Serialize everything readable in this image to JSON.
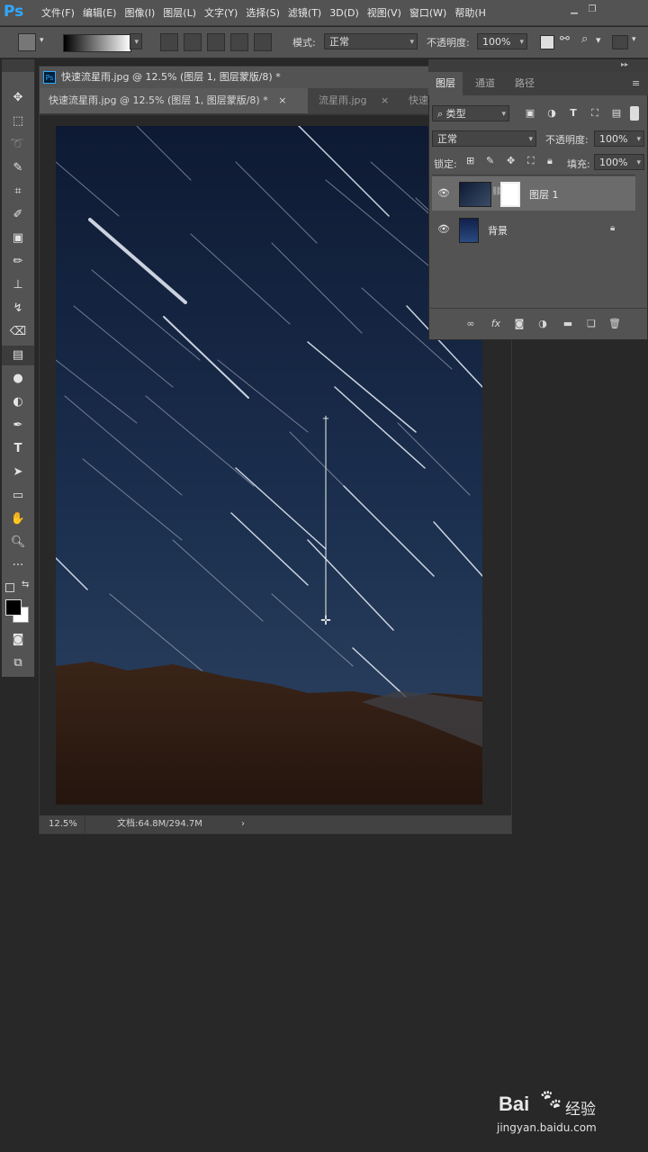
{
  "app": {
    "logo": "Ps",
    "brand_color": "#31a8ff"
  },
  "menu": {
    "items": [
      "文件(F)",
      "编辑(E)",
      "图像(I)",
      "图层(L)",
      "文字(Y)",
      "选择(S)",
      "滤镜(T)",
      "3D(D)",
      "视图(V)",
      "窗口(W)",
      "帮助(H"
    ],
    "window_controls": [
      "minimize-icon",
      "restore-icon"
    ]
  },
  "options_bar": {
    "mode_label": "模式:",
    "mode_value": "正常",
    "opacity_label": "不透明度:",
    "opacity_value": "100%",
    "gradient_colors": [
      "#000000",
      "#ffffff"
    ]
  },
  "document": {
    "title": "快速流星雨.jpg @ 12.5% (图层 1, 图层蒙版/8) *",
    "tabs": [
      {
        "label": "快速流星雨.jpg @ 12.5% (图层 1, 图层蒙版/8) *",
        "active": true
      },
      {
        "label": "流星雨.jpg",
        "active": false
      },
      {
        "label": "快速",
        "active": false
      }
    ],
    "tab_close_glyph": "×",
    "status": {
      "zoom": "12.5%",
      "doc_size": "文档:64.8M/294.7M",
      "arrow": "›"
    }
  },
  "layers_panel": {
    "tabs": [
      "图层",
      "通道",
      "路径"
    ],
    "active_tab": "图层",
    "filter_label": "类型",
    "blend_mode": "正常",
    "opacity_label": "不透明度:",
    "opacity_value": "100%",
    "lock_label": "锁定:",
    "fill_label": "填充:",
    "fill_value": "100%",
    "layers": [
      {
        "name": "图层 1",
        "has_mask": true,
        "selected": true,
        "locked": false
      },
      {
        "name": "背景",
        "has_mask": false,
        "selected": false,
        "locked": true
      }
    ]
  },
  "watermark": {
    "brand": "Bai",
    "brand_suffix": "经验",
    "url": "jingyan.baidu.com"
  }
}
